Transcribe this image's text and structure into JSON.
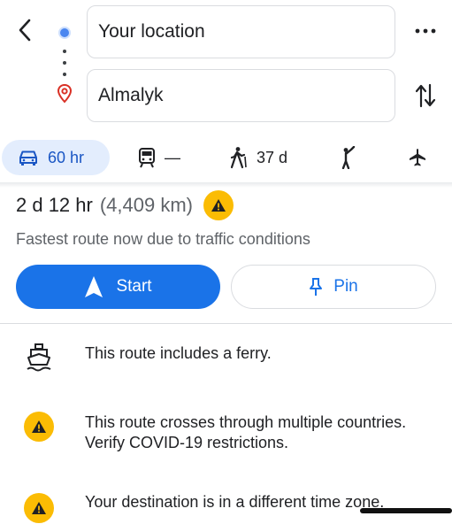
{
  "header": {
    "origin": {
      "value": "Your location"
    },
    "destination": {
      "value": "Almalyk"
    },
    "icons": {
      "back": "chevron-left-icon",
      "more": "more-dots-icon",
      "swap": "swap-vertical-icon",
      "origin": "location-dot-icon",
      "destination": "map-pin-icon"
    }
  },
  "modes": [
    {
      "name": "driving",
      "icon": "car-icon",
      "label": "60 hr",
      "selected": true
    },
    {
      "name": "transit",
      "icon": "train-icon",
      "label": "—"
    },
    {
      "name": "walking",
      "icon": "walking-icon",
      "label": "37 d"
    },
    {
      "name": "ride",
      "icon": "ride-hail-icon",
      "label": ""
    },
    {
      "name": "flight",
      "icon": "airplane-icon",
      "label": ""
    }
  ],
  "route": {
    "duration": "2 d 12 hr",
    "distance": "(4,409 km)",
    "description": "Fastest route now due to traffic conditions"
  },
  "actions": {
    "start_label": "Start",
    "pin_label": "Pin"
  },
  "notices": [
    {
      "icon": "ferry-icon",
      "text": "This route includes a ferry."
    },
    {
      "icon": "warning-icon",
      "text": "This route crosses through multiple countries. Verify COVID-19 restrictions."
    },
    {
      "icon": "warning-icon",
      "text": "Your destination is in a different time zone."
    }
  ],
  "colors": {
    "accent": "#1a73e8",
    "selected_mode_bg": "#e3edfd",
    "warning": "#fbbc04",
    "origin_dot": "#4a86f0",
    "destination_pin": "#d93025"
  }
}
